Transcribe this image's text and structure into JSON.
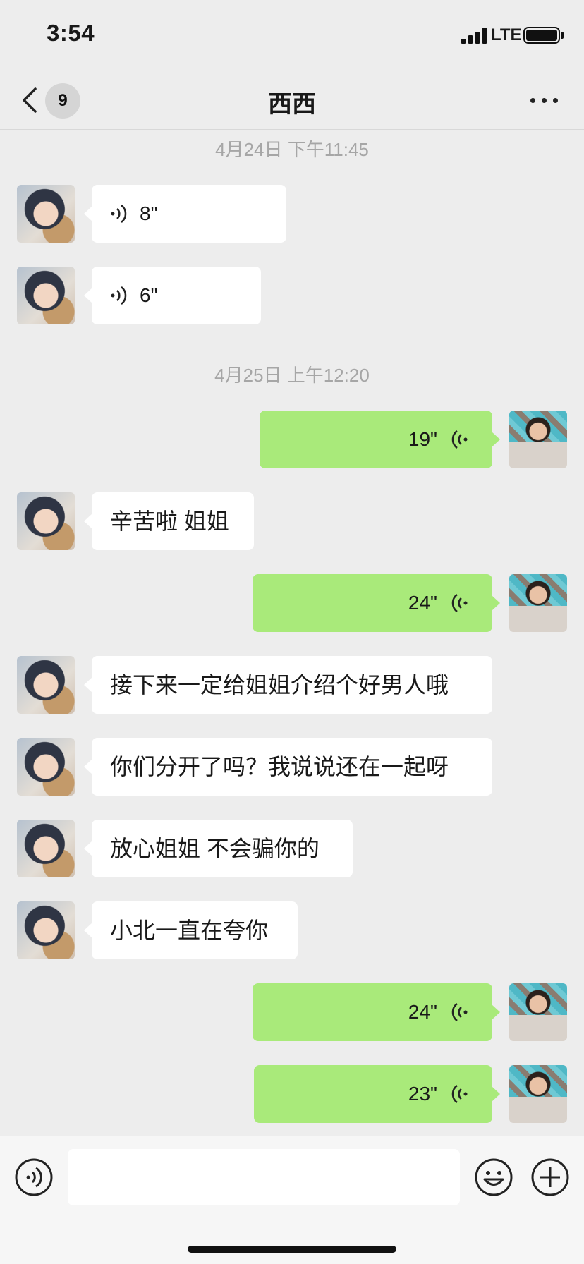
{
  "status_bar": {
    "time": "3:54",
    "network": "LTE",
    "icons": [
      "signal-icon",
      "battery-icon"
    ]
  },
  "nav": {
    "title": "西西",
    "unread_count": "9",
    "icons": [
      "back-chevron-icon",
      "more-dots-icon"
    ]
  },
  "colors": {
    "background": "#ededed",
    "incoming_bubble": "#ffffff",
    "outgoing_bubble": "#a9ea7a",
    "timestamp_text": "#a6a6a6"
  },
  "messages": [
    {
      "kind": "timestamp",
      "text": "4月24日 下午11:45"
    },
    {
      "kind": "voice",
      "side": "in",
      "duration": "8\""
    },
    {
      "kind": "voice",
      "side": "in",
      "duration": "6\""
    },
    {
      "kind": "timestamp",
      "text": "4月25日 上午12:20"
    },
    {
      "kind": "voice",
      "side": "out",
      "duration": "19\""
    },
    {
      "kind": "text",
      "side": "in",
      "text": "辛苦啦 姐姐"
    },
    {
      "kind": "voice",
      "side": "out",
      "duration": "24\""
    },
    {
      "kind": "text",
      "side": "in",
      "text": "接下来一定给姐姐介绍个好男人哦"
    },
    {
      "kind": "text",
      "side": "in",
      "text": "你们分开了吗？我说说还在一起呀"
    },
    {
      "kind": "text",
      "side": "in",
      "text": "放心姐姐 不会骗你的"
    },
    {
      "kind": "text",
      "side": "in",
      "text": "小北一直在夸你"
    },
    {
      "kind": "voice",
      "side": "out",
      "duration": "24\""
    },
    {
      "kind": "voice",
      "side": "out",
      "duration": "23\""
    }
  ],
  "input_bar": {
    "text_value": "",
    "icons": [
      "voice-input-icon",
      "emoji-icon",
      "plus-icon"
    ]
  }
}
